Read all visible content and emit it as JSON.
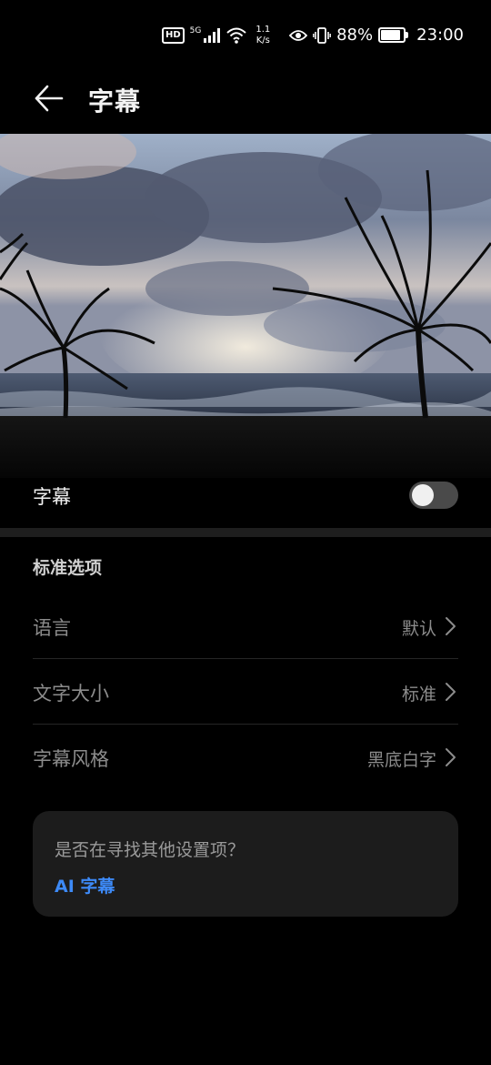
{
  "status_bar": {
    "hd": "HD",
    "network": "5G",
    "net_rate_value": "1.1",
    "net_rate_unit": "K/s",
    "battery_percent": "88%",
    "battery_level": 0.88,
    "time": "23:00",
    "icons": [
      "hd-icon",
      "signal-icon",
      "wifi-icon",
      "eye-icon",
      "vibrate-icon",
      "battery-icon"
    ]
  },
  "header": {
    "title": "字幕",
    "back_icon": "arrow-left-icon"
  },
  "subtitles_toggle": {
    "label": "字幕",
    "enabled": false
  },
  "standard_options": {
    "title": "标准选项",
    "items": [
      {
        "label": "语言",
        "value": "默认"
      },
      {
        "label": "文字大小",
        "value": "标准"
      },
      {
        "label": "字幕风格",
        "value": "黑底白字"
      }
    ]
  },
  "suggestion_card": {
    "question": "是否在寻找其他设置项？",
    "link": "AI 字幕"
  },
  "colors": {
    "background": "#000000",
    "accent": "#3d8af7",
    "toggle_off": "#4a4a4a"
  }
}
